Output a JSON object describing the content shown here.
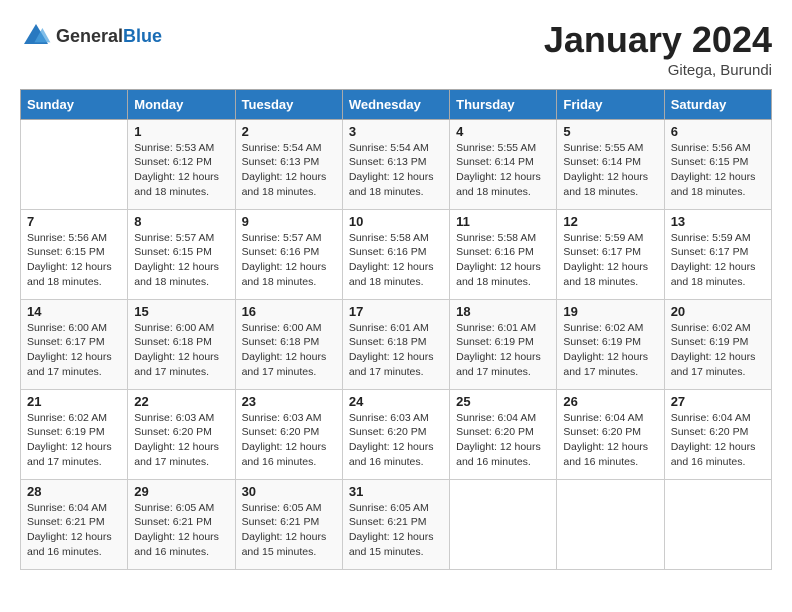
{
  "logo": {
    "general": "General",
    "blue": "Blue"
  },
  "title": "January 2024",
  "location": "Gitega, Burundi",
  "days_of_week": [
    "Sunday",
    "Monday",
    "Tuesday",
    "Wednesday",
    "Thursday",
    "Friday",
    "Saturday"
  ],
  "weeks": [
    [
      {
        "day": "",
        "sunrise": "",
        "sunset": "",
        "daylight": ""
      },
      {
        "day": "1",
        "sunrise": "Sunrise: 5:53 AM",
        "sunset": "Sunset: 6:12 PM",
        "daylight": "Daylight: 12 hours and 18 minutes."
      },
      {
        "day": "2",
        "sunrise": "Sunrise: 5:54 AM",
        "sunset": "Sunset: 6:13 PM",
        "daylight": "Daylight: 12 hours and 18 minutes."
      },
      {
        "day": "3",
        "sunrise": "Sunrise: 5:54 AM",
        "sunset": "Sunset: 6:13 PM",
        "daylight": "Daylight: 12 hours and 18 minutes."
      },
      {
        "day": "4",
        "sunrise": "Sunrise: 5:55 AM",
        "sunset": "Sunset: 6:14 PM",
        "daylight": "Daylight: 12 hours and 18 minutes."
      },
      {
        "day": "5",
        "sunrise": "Sunrise: 5:55 AM",
        "sunset": "Sunset: 6:14 PM",
        "daylight": "Daylight: 12 hours and 18 minutes."
      },
      {
        "day": "6",
        "sunrise": "Sunrise: 5:56 AM",
        "sunset": "Sunset: 6:15 PM",
        "daylight": "Daylight: 12 hours and 18 minutes."
      }
    ],
    [
      {
        "day": "7",
        "sunrise": "Sunrise: 5:56 AM",
        "sunset": "Sunset: 6:15 PM",
        "daylight": "Daylight: 12 hours and 18 minutes."
      },
      {
        "day": "8",
        "sunrise": "Sunrise: 5:57 AM",
        "sunset": "Sunset: 6:15 PM",
        "daylight": "Daylight: 12 hours and 18 minutes."
      },
      {
        "day": "9",
        "sunrise": "Sunrise: 5:57 AM",
        "sunset": "Sunset: 6:16 PM",
        "daylight": "Daylight: 12 hours and 18 minutes."
      },
      {
        "day": "10",
        "sunrise": "Sunrise: 5:58 AM",
        "sunset": "Sunset: 6:16 PM",
        "daylight": "Daylight: 12 hours and 18 minutes."
      },
      {
        "day": "11",
        "sunrise": "Sunrise: 5:58 AM",
        "sunset": "Sunset: 6:16 PM",
        "daylight": "Daylight: 12 hours and 18 minutes."
      },
      {
        "day": "12",
        "sunrise": "Sunrise: 5:59 AM",
        "sunset": "Sunset: 6:17 PM",
        "daylight": "Daylight: 12 hours and 18 minutes."
      },
      {
        "day": "13",
        "sunrise": "Sunrise: 5:59 AM",
        "sunset": "Sunset: 6:17 PM",
        "daylight": "Daylight: 12 hours and 18 minutes."
      }
    ],
    [
      {
        "day": "14",
        "sunrise": "Sunrise: 6:00 AM",
        "sunset": "Sunset: 6:17 PM",
        "daylight": "Daylight: 12 hours and 17 minutes."
      },
      {
        "day": "15",
        "sunrise": "Sunrise: 6:00 AM",
        "sunset": "Sunset: 6:18 PM",
        "daylight": "Daylight: 12 hours and 17 minutes."
      },
      {
        "day": "16",
        "sunrise": "Sunrise: 6:00 AM",
        "sunset": "Sunset: 6:18 PM",
        "daylight": "Daylight: 12 hours and 17 minutes."
      },
      {
        "day": "17",
        "sunrise": "Sunrise: 6:01 AM",
        "sunset": "Sunset: 6:18 PM",
        "daylight": "Daylight: 12 hours and 17 minutes."
      },
      {
        "day": "18",
        "sunrise": "Sunrise: 6:01 AM",
        "sunset": "Sunset: 6:19 PM",
        "daylight": "Daylight: 12 hours and 17 minutes."
      },
      {
        "day": "19",
        "sunrise": "Sunrise: 6:02 AM",
        "sunset": "Sunset: 6:19 PM",
        "daylight": "Daylight: 12 hours and 17 minutes."
      },
      {
        "day": "20",
        "sunrise": "Sunrise: 6:02 AM",
        "sunset": "Sunset: 6:19 PM",
        "daylight": "Daylight: 12 hours and 17 minutes."
      }
    ],
    [
      {
        "day": "21",
        "sunrise": "Sunrise: 6:02 AM",
        "sunset": "Sunset: 6:19 PM",
        "daylight": "Daylight: 12 hours and 17 minutes."
      },
      {
        "day": "22",
        "sunrise": "Sunrise: 6:03 AM",
        "sunset": "Sunset: 6:20 PM",
        "daylight": "Daylight: 12 hours and 17 minutes."
      },
      {
        "day": "23",
        "sunrise": "Sunrise: 6:03 AM",
        "sunset": "Sunset: 6:20 PM",
        "daylight": "Daylight: 12 hours and 16 minutes."
      },
      {
        "day": "24",
        "sunrise": "Sunrise: 6:03 AM",
        "sunset": "Sunset: 6:20 PM",
        "daylight": "Daylight: 12 hours and 16 minutes."
      },
      {
        "day": "25",
        "sunrise": "Sunrise: 6:04 AM",
        "sunset": "Sunset: 6:20 PM",
        "daylight": "Daylight: 12 hours and 16 minutes."
      },
      {
        "day": "26",
        "sunrise": "Sunrise: 6:04 AM",
        "sunset": "Sunset: 6:20 PM",
        "daylight": "Daylight: 12 hours and 16 minutes."
      },
      {
        "day": "27",
        "sunrise": "Sunrise: 6:04 AM",
        "sunset": "Sunset: 6:20 PM",
        "daylight": "Daylight: 12 hours and 16 minutes."
      }
    ],
    [
      {
        "day": "28",
        "sunrise": "Sunrise: 6:04 AM",
        "sunset": "Sunset: 6:21 PM",
        "daylight": "Daylight: 12 hours and 16 minutes."
      },
      {
        "day": "29",
        "sunrise": "Sunrise: 6:05 AM",
        "sunset": "Sunset: 6:21 PM",
        "daylight": "Daylight: 12 hours and 16 minutes."
      },
      {
        "day": "30",
        "sunrise": "Sunrise: 6:05 AM",
        "sunset": "Sunset: 6:21 PM",
        "daylight": "Daylight: 12 hours and 15 minutes."
      },
      {
        "day": "31",
        "sunrise": "Sunrise: 6:05 AM",
        "sunset": "Sunset: 6:21 PM",
        "daylight": "Daylight: 12 hours and 15 minutes."
      },
      {
        "day": "",
        "sunrise": "",
        "sunset": "",
        "daylight": ""
      },
      {
        "day": "",
        "sunrise": "",
        "sunset": "",
        "daylight": ""
      },
      {
        "day": "",
        "sunrise": "",
        "sunset": "",
        "daylight": ""
      }
    ]
  ]
}
